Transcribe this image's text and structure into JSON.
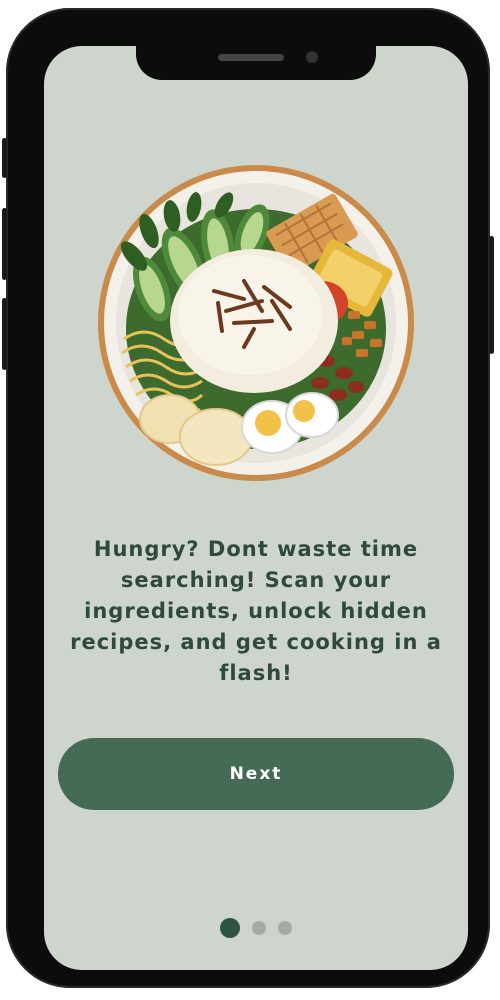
{
  "onboarding": {
    "message": "Hungry? Dont waste time searching! Scan your ingredients, unlock hidden recipes, and get cooking in a flash!",
    "next_label": "Next",
    "pagination": {
      "total_pages": 3,
      "current_page": 1
    },
    "illustration_icon": "rice-bowl-icon"
  },
  "colors": {
    "screen_background": "#cdd5cd",
    "primary_button": "#456a56",
    "text": "#2f4a3a",
    "dot_active": "#2f5342",
    "dot_inactive": "#a4a9a4"
  }
}
